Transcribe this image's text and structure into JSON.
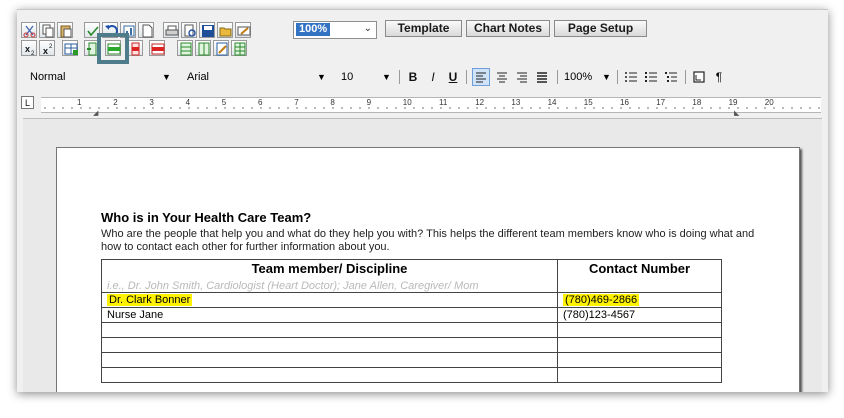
{
  "toolbar": {
    "zoom_value": "100%",
    "buttons": [
      "Template",
      "Chart Notes",
      "Page Setup"
    ],
    "selected_button_icon": "insert-row-icon"
  },
  "format_bar": {
    "style": "Normal",
    "font": "Arial",
    "size": "10",
    "bold": "B",
    "italic": "I",
    "underline": "U",
    "paragraph_zoom": "100%",
    "pilcrow": "¶"
  },
  "ruler": {
    "numbers": [
      "1",
      "2",
      "3",
      "4",
      "5",
      "6",
      "7",
      "8",
      "9",
      "10",
      "11",
      "12",
      "13",
      "14",
      "15",
      "16",
      "17",
      "18",
      "19",
      "20"
    ]
  },
  "document": {
    "heading": "Who is in Your Health Care Team?",
    "intro": "Who are the people that help you and what do they help you with? This helps the different team members know who is doing what and how to contact each other for further information about you.",
    "table": {
      "headers": [
        "Team member/ Discipline",
        "Contact Number"
      ],
      "hint": "i.e., Dr. John Smith, Cardiologist (Heart Doctor); Jane Allen, Caregiver/ Mom",
      "rows": [
        {
          "member": "Dr. Clark Bonner",
          "contact": "(780)469-2866",
          "highlighted": true
        },
        {
          "member": "Nurse Jane",
          "contact": "(780)123-4567",
          "highlighted": false
        },
        {
          "member": "",
          "contact": "",
          "highlighted": false
        },
        {
          "member": "",
          "contact": "",
          "highlighted": false
        },
        {
          "member": "",
          "contact": "",
          "highlighted": false
        },
        {
          "member": "",
          "contact": "",
          "highlighted": false
        }
      ]
    }
  },
  "colors": {
    "highlight": "#fff200",
    "selection_box": "#4f7c8b",
    "zoom_selection": "#3373c4"
  }
}
